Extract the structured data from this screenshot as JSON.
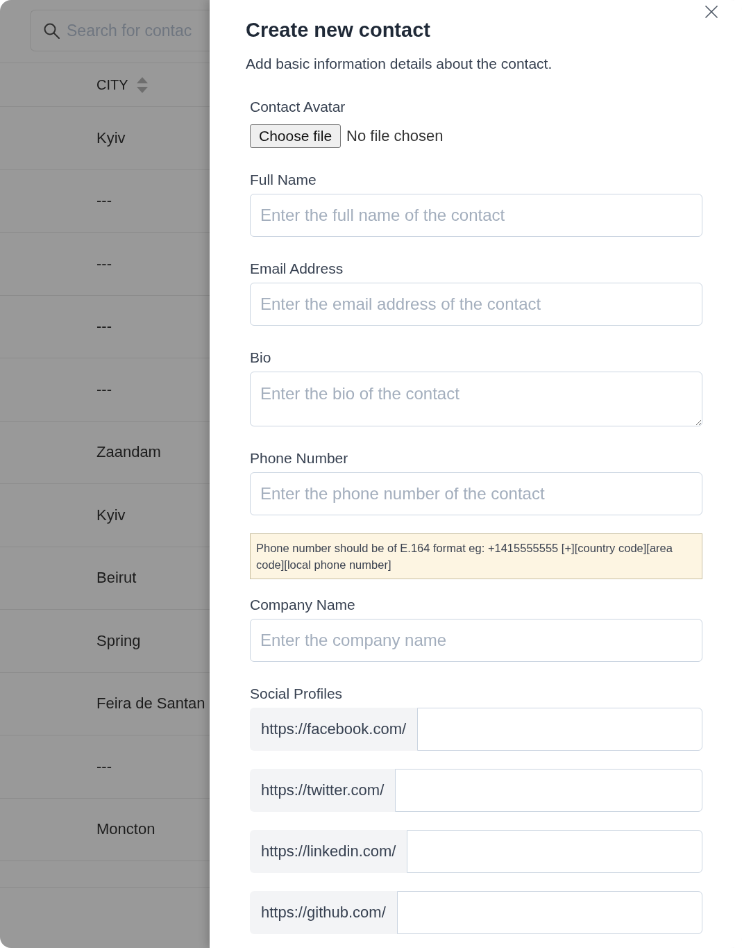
{
  "search": {
    "placeholder": "Search for contac"
  },
  "table": {
    "columns": [
      {
        "label": "CITY",
        "sortable": true
      }
    ],
    "rows": [
      {
        "city": "Kyiv"
      },
      {
        "city": "---"
      },
      {
        "city": "---"
      },
      {
        "city": "---"
      },
      {
        "city": "---"
      },
      {
        "city": "Zaandam"
      },
      {
        "city": "Kyiv"
      },
      {
        "city": "Beirut"
      },
      {
        "city": "Spring"
      },
      {
        "city": "Feira de Santan"
      },
      {
        "city": "---"
      },
      {
        "city": "Moncton"
      }
    ]
  },
  "drawer": {
    "title": "Create new contact",
    "subtitle": "Add basic information details about the contact.",
    "fields": [
      {
        "kind": "file",
        "label": "Contact Avatar",
        "button": "Choose file",
        "status": "No file chosen"
      },
      {
        "kind": "text",
        "label": "Full Name",
        "placeholder": "Enter the full name of the contact"
      },
      {
        "kind": "text",
        "label": "Email Address",
        "placeholder": "Enter the email address of the contact"
      },
      {
        "kind": "textarea",
        "label": "Bio",
        "placeholder": "Enter the bio of the contact"
      },
      {
        "kind": "text",
        "label": "Phone Number",
        "placeholder": "Enter the phone number of the contact",
        "hint": "Phone number should be of E.164 format eg: +1415555555 [+][country code][area code][local phone number]"
      },
      {
        "kind": "text",
        "label": "Company Name",
        "placeholder": "Enter the company name"
      },
      {
        "kind": "social",
        "label": "Social Profiles",
        "items": [
          {
            "prefix": "https://facebook.com/"
          },
          {
            "prefix": "https://twitter.com/"
          },
          {
            "prefix": "https://linkedin.com/"
          },
          {
            "prefix": "https://github.com/"
          }
        ]
      }
    ]
  }
}
